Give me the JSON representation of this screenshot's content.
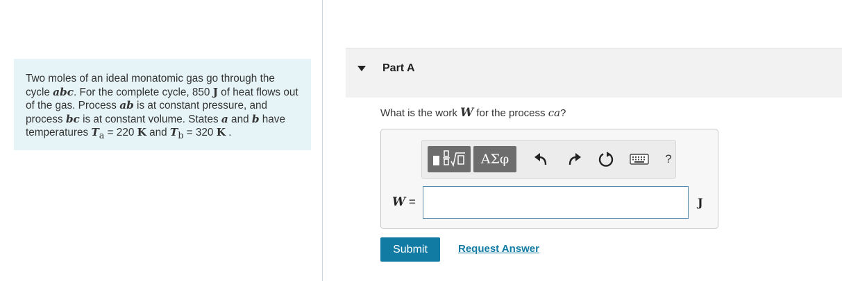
{
  "problem": {
    "t1": "Two moles of an ideal monatomic gas go through the cycle ",
    "cycle_var": "abc",
    "t2": ". For the complete cycle, 850 ",
    "heat_unit": "J",
    "t3": " of heat flows out of the gas. Process ",
    "proc1": "ab",
    "t4": " is at constant pressure, and process ",
    "proc2": "bc",
    "t5": " is at constant volume. States ",
    "state_a": "a",
    "t6": " and ",
    "state_b": "b",
    "t7": " have temperatures ",
    "ta_sym": "T",
    "ta_sub": "a",
    "ta_eq": " = 220 ",
    "ta_unit": "K",
    "t8": " and ",
    "tb_sym": "T",
    "tb_sub": "b",
    "tb_eq": " = 320 ",
    "tb_unit": "K",
    "t9": " ."
  },
  "part": {
    "title": "Part A"
  },
  "question": {
    "t1": "What is the work ",
    "var": "W",
    "t2": " for the process ",
    "proc": "ca",
    "t3": "?"
  },
  "toolbar": {
    "greek_label": "ΑΣφ",
    "help_label": "?"
  },
  "answer": {
    "var_label": "W",
    "equals": " =",
    "value": "",
    "unit": "J"
  },
  "actions": {
    "submit_label": "Submit",
    "request_label": "Request Answer"
  },
  "colors": {
    "accent": "#127ba4",
    "problem_bg": "#e6f4f7",
    "toolbar_btn": "#6d6d6d"
  }
}
